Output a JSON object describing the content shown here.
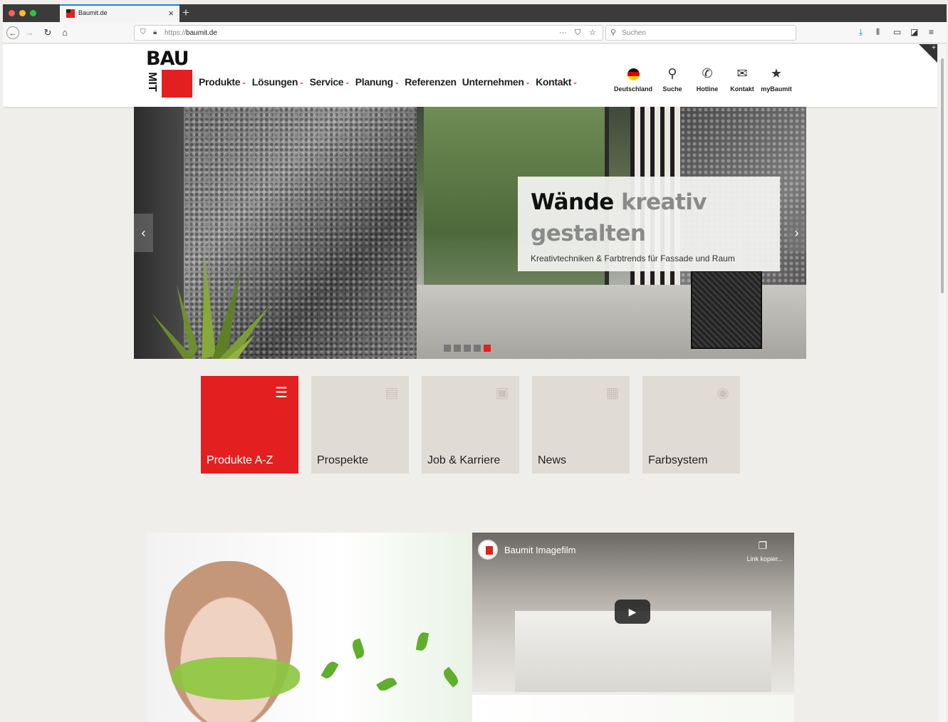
{
  "browser": {
    "tab_title": "Baumit.de",
    "url_protocol": "https://",
    "url_host": "baumit.de",
    "search_placeholder": "Suchen",
    "colors": {
      "tab_accent": "#0a84ff",
      "traffic_red": "#ff5f57",
      "traffic_yellow": "#febc2e",
      "traffic_green": "#28c840"
    }
  },
  "site": {
    "brand_color": "#e41f1f",
    "logo_top": "BAU",
    "logo_side": "MIT",
    "nav": [
      {
        "label": "Produkte",
        "has_menu": true
      },
      {
        "label": "Lösungen",
        "has_menu": true
      },
      {
        "label": "Service",
        "has_menu": true
      },
      {
        "label": "Planung",
        "has_menu": true
      },
      {
        "label": "Referenzen",
        "has_menu": false
      },
      {
        "label": "Unternehmen",
        "has_menu": true
      },
      {
        "label": "Kontakt",
        "has_menu": true
      }
    ],
    "utility": [
      {
        "label": "Deutschland",
        "icon": "germany-flag-icon"
      },
      {
        "label": "Suche",
        "icon": "search-icon"
      },
      {
        "label": "Hotline",
        "icon": "phone-icon"
      },
      {
        "label": "Kontakt",
        "icon": "mail-icon"
      },
      {
        "label": "myBaumit",
        "icon": "star-icon"
      }
    ]
  },
  "hero": {
    "title_dark": "Wände",
    "title_light_1": "kreativ",
    "title_light_2": "gestalten",
    "subtitle": "Kreativtechniken & Farbtrends für Fassade und Raum",
    "slides_total": 5,
    "active_slide": 5
  },
  "tiles": [
    {
      "label": "Produkte A-Z",
      "icon": "list-icon",
      "active": true
    },
    {
      "label": "Prospekte",
      "icon": "gallery-icon",
      "active": false
    },
    {
      "label": "Job & Karriere",
      "icon": "briefcase-icon",
      "active": false
    },
    {
      "label": "News",
      "icon": "newspaper-icon",
      "active": false
    },
    {
      "label": "Farbsystem",
      "icon": "palette-icon",
      "active": false
    }
  ],
  "video": {
    "title": "Baumit Imagefilm",
    "copy_label": "Link kopier..."
  }
}
